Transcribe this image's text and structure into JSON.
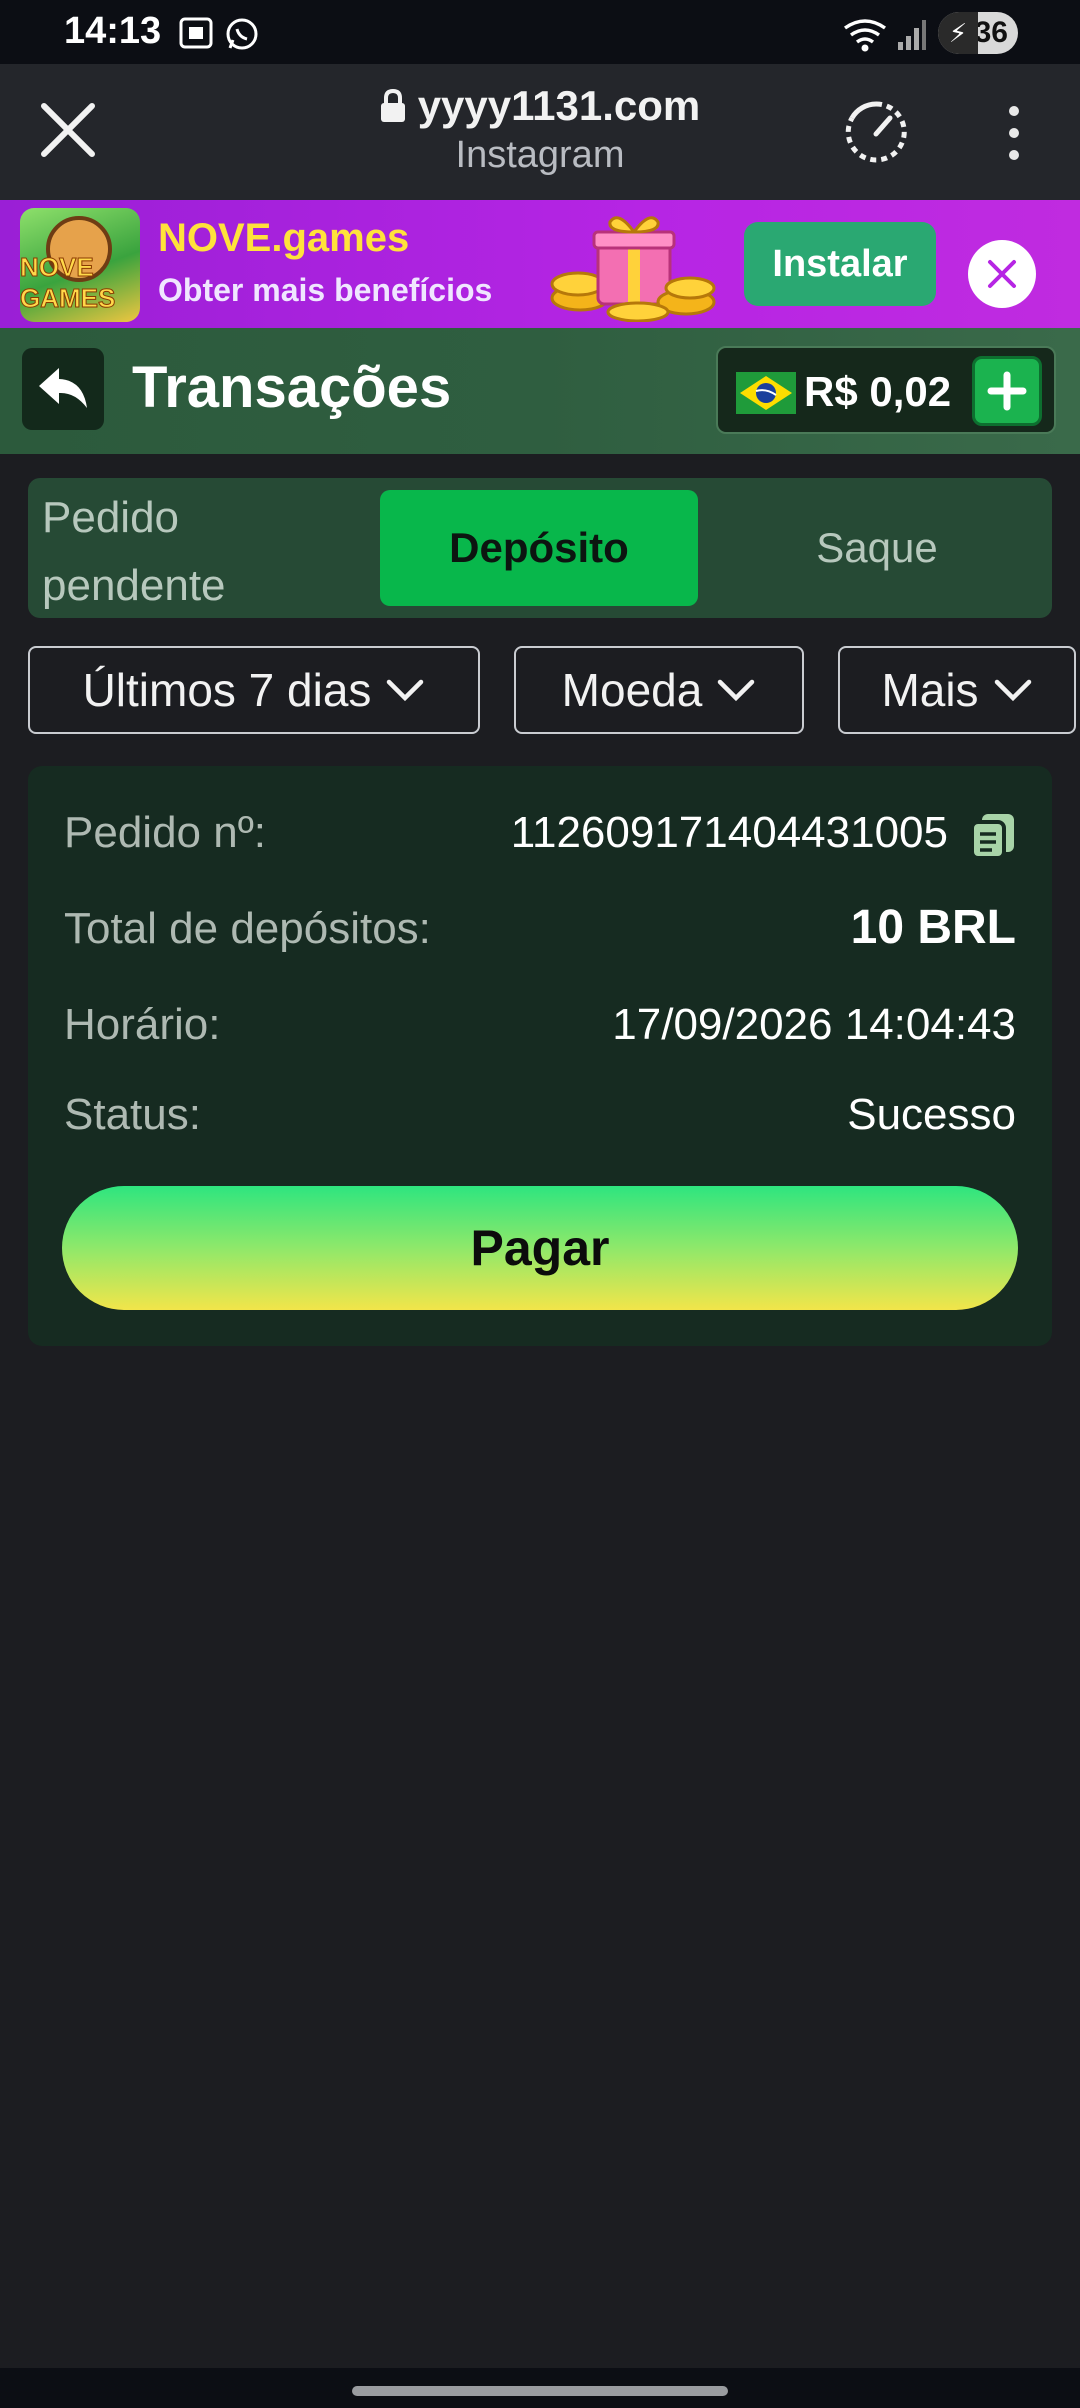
{
  "status_bar": {
    "time": "14:13",
    "battery": "36",
    "icons": [
      "screenshot-icon",
      "whatsapp-icon",
      "wifi-icon",
      "signal-icon",
      "battery-icon"
    ]
  },
  "browser": {
    "url": "yyyy1131.com",
    "source": "Instagram",
    "icons": [
      "close-icon",
      "lock-icon",
      "speedometer-icon",
      "more-vert-icon"
    ]
  },
  "promo": {
    "logo_text": "NOVE GAMES",
    "title": "NOVE.games",
    "subtitle": "Obter mais benefícios",
    "install_label": "Instalar",
    "colors": {
      "background": "#b625e4",
      "title": "#ffe23b",
      "install": "#2aa872"
    }
  },
  "header": {
    "title": "Transações",
    "balance": "R$ 0,02",
    "icons": [
      "back-arrow-icon",
      "brazil-flag-icon",
      "plus-icon"
    ]
  },
  "tabs": {
    "pending": "Pedido pendente",
    "deposit": "Depósito",
    "withdraw": "Saque",
    "active": "Depósito"
  },
  "filters": {
    "period": "Últimos 7 dias",
    "currency": "Moeda",
    "more": "Mais"
  },
  "order": {
    "id_label": "Pedido nº:",
    "id_value": "112609171404431005",
    "total_label": "Total de depósitos:",
    "total_value": "10 BRL",
    "time_label": "Horário:",
    "time_value": "17/09/2026 14:04:43",
    "status_label": "Status:",
    "status_value": "Sucesso",
    "pay_label": "Pagar"
  },
  "colors": {
    "accent_green": "#08b74b",
    "page_bg": "#1c1d21",
    "card_bg": "#162b21"
  }
}
